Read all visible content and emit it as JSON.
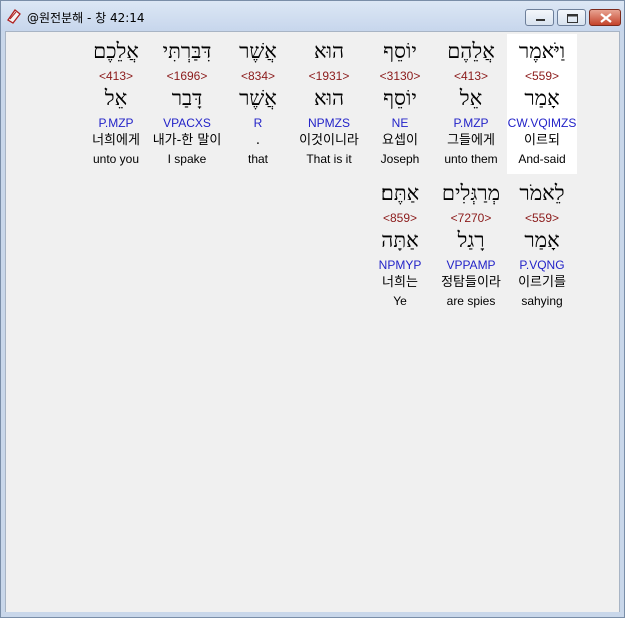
{
  "window": {
    "title": "@원전분해 - 창 42:14"
  },
  "rows": [
    [
      {
        "heb": "וַיֹּאמֶר",
        "strong": "<559>",
        "lemma": "אָמַר",
        "morph": "CW.VQIMZS",
        "kor": "이르되",
        "eng": "And-said"
      },
      {
        "heb": "אֲלֵהֶם",
        "strong": "<413>",
        "lemma": "אֵל",
        "morph": "P.MZP",
        "kor": "그들에게",
        "eng": "unto them"
      },
      {
        "heb": "יוֹסֵף",
        "strong": "<3130>",
        "lemma": "יוֹסֵף",
        "morph": "NE",
        "kor": "요셉이",
        "eng": "Joseph"
      },
      {
        "heb": "הוּא",
        "strong": "<1931>",
        "lemma": "הוּא",
        "morph": "NPMZS",
        "kor": "이것이니라",
        "eng": "That is it"
      },
      {
        "heb": "אֲשֶׁר",
        "strong": "<834>",
        "lemma": "אֲשֶׁר",
        "morph": "R",
        "kor": ".",
        "eng": "that"
      },
      {
        "heb": "דִּבַּרְתִּי",
        "strong": "<1696>",
        "lemma": "דָּבַר",
        "morph": "VPACXS",
        "kor": "내가-한 말이",
        "eng": "I spake"
      },
      {
        "heb": "אֲלֵכֶם",
        "strong": "<413>",
        "lemma": "אֵל",
        "morph": "P.MZP",
        "kor": "너희에게",
        "eng": "unto you"
      }
    ],
    [
      {
        "heb": "לֵאמֹר",
        "strong": "<559>",
        "lemma": "אָמַר",
        "morph": "P.VQNG",
        "kor": "이르기를",
        "eng": "sahying"
      },
      {
        "heb": "מְרַגְּלִים",
        "strong": "<7270>",
        "lemma": "רָגַל",
        "morph": "VPPAMP",
        "kor": "정탐들이라",
        "eng": "are spies"
      },
      {
        "heb": "אַתֶּם׃",
        "strong": "<859>",
        "lemma": "אַתָּה",
        "morph": "NPMYP",
        "kor": "너희는",
        "eng": "Ye"
      }
    ]
  ]
}
